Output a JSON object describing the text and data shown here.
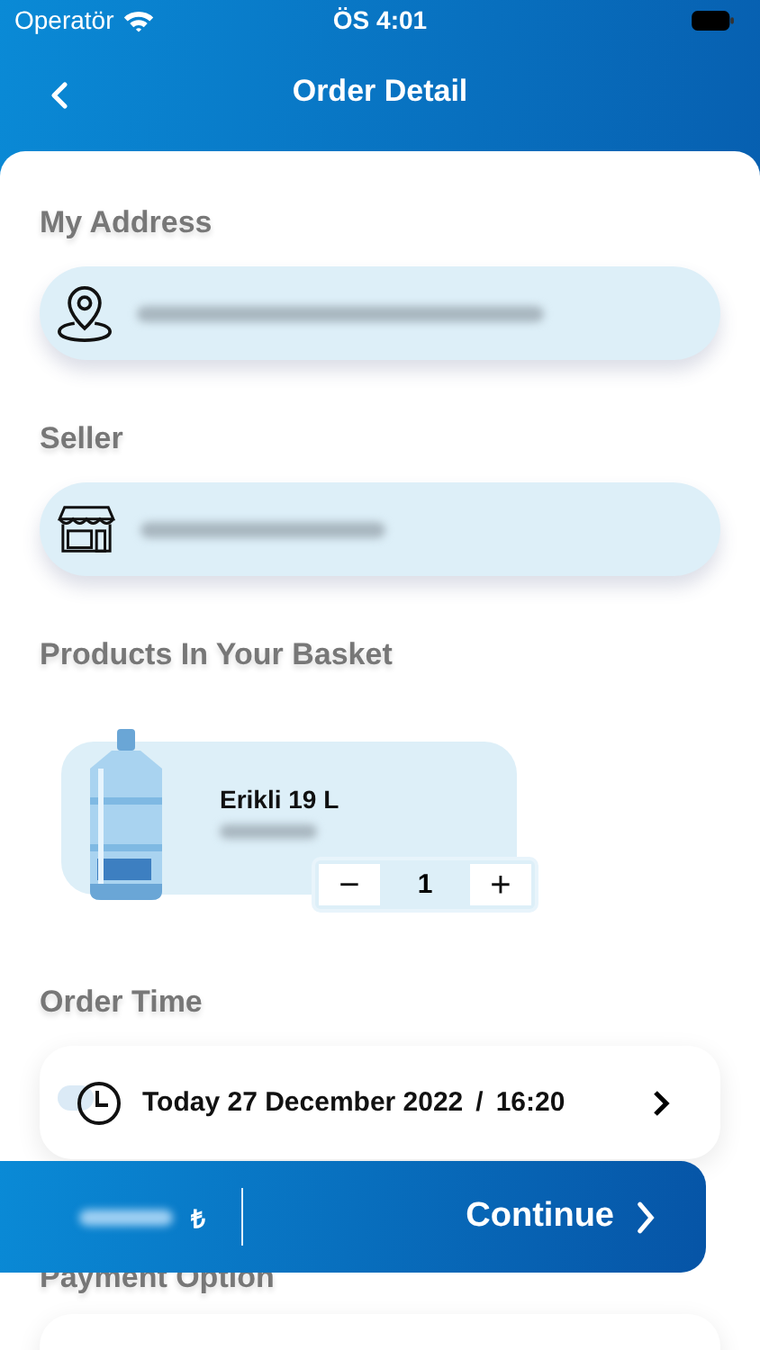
{
  "status_bar": {
    "carrier": "Operatör",
    "time": "ÖS 4:01"
  },
  "nav": {
    "title": "Order Detail"
  },
  "address": {
    "label": "My Address"
  },
  "seller": {
    "label": "Seller"
  },
  "basket": {
    "label": "Products In Your Basket",
    "products": [
      {
        "name": "Erikli 19 L",
        "quantity": "1",
        "minus": "−",
        "plus": "+"
      }
    ]
  },
  "order_time": {
    "label": "Order Time",
    "date": "Today 27 December 2022",
    "separator": "/",
    "time": "16:20"
  },
  "payment": {
    "label": "Payment Option"
  },
  "footer": {
    "currency": "₺",
    "action": "Continue"
  }
}
